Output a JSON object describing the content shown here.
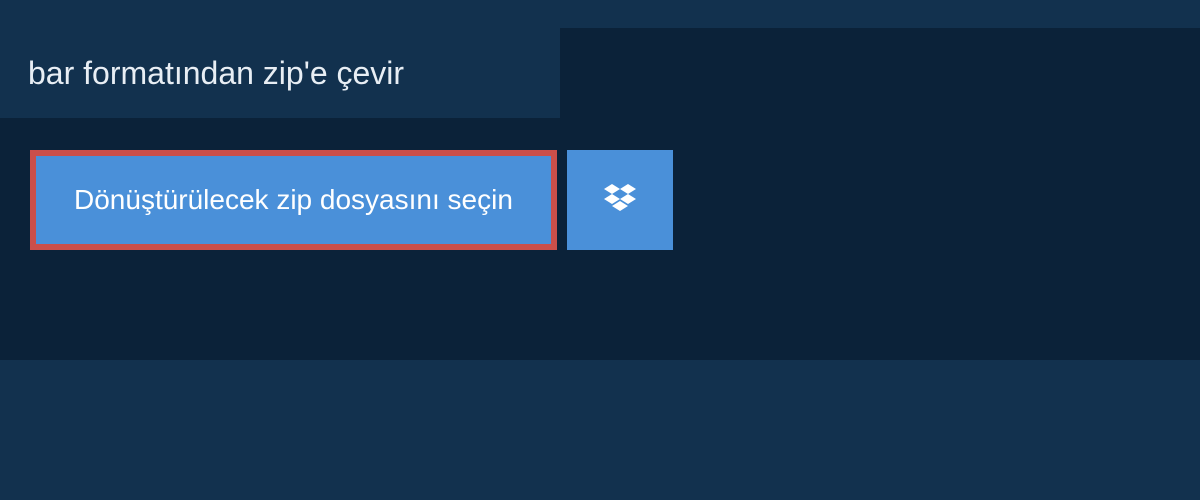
{
  "header": {
    "title": "bar formatından zip'e çevir"
  },
  "actions": {
    "select_file_label": "Dönüştürülecek zip dosyasını seçin",
    "dropbox_icon_name": "dropbox-icon"
  },
  "colors": {
    "background": "#12314e",
    "dark_band": "#0b2239",
    "button_primary": "#4a90d9",
    "button_highlight_border": "#cb4f4a",
    "text_light": "#e8eef4",
    "text_white": "#ffffff"
  }
}
